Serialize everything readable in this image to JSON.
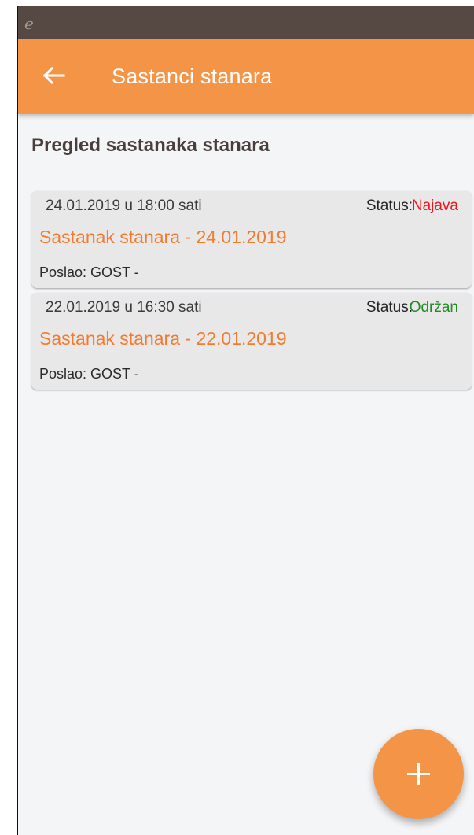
{
  "status_bar": {
    "app_glyph": "e"
  },
  "app_bar": {
    "title": "Sastanci stanara",
    "back_icon": "arrow-left-icon"
  },
  "page": {
    "heading": "Pregled sastanaka stanara"
  },
  "meetings": [
    {
      "datetime": "24.01.2019 u 18:00 sati",
      "status_label": "Status:",
      "status": "Najava",
      "status_color": "#f0141e",
      "title": "Sastanak stanara - 24.01.2019",
      "sender": "Poslao: GOST -"
    },
    {
      "datetime": "22.01.2019 u 16:30 sati",
      "status_label": "Status:",
      "status": "Održan",
      "status_color": "#1e8c1e",
      "title": "Sastanak stanara - 22.01.2019",
      "sender": "Poslao: GOST -"
    }
  ],
  "fab": {
    "icon": "plus-icon"
  },
  "colors": {
    "accent": "#f39447",
    "status_bar": "#564843",
    "title_orange": "#f47a2e"
  }
}
